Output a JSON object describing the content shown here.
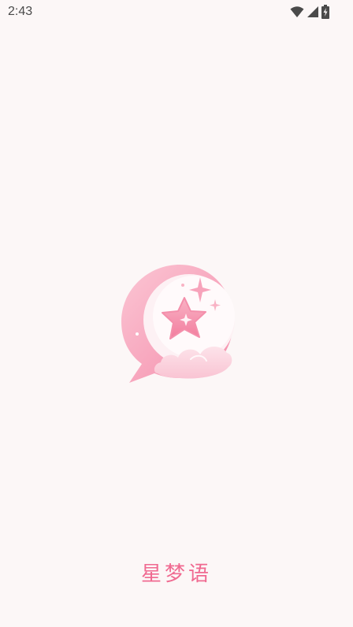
{
  "status_bar": {
    "time": "2:43",
    "icons": [
      "wifi-icon",
      "cellular-signal-icon",
      "battery-charging-icon"
    ]
  },
  "splash": {
    "logo": "star-moon-chat-bubble-logo",
    "app_name": "星梦语"
  },
  "colors": {
    "background": "#fcf7f7",
    "accent": "#f06a91",
    "logo_pink": "#f7a3bb",
    "status_text": "#4a4a4a"
  }
}
